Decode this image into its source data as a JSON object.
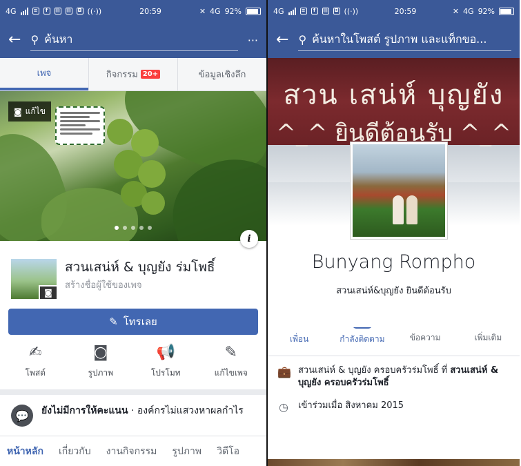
{
  "left": {
    "status": {
      "network": "4G",
      "time": "20:59",
      "battery": "92%",
      "net2": "4G"
    },
    "search": {
      "placeholder": "ค้นหา",
      "more": "···"
    },
    "tabs": [
      {
        "label": "เพจ",
        "active": true
      },
      {
        "label": "กิจกรรม",
        "badge": "20+"
      },
      {
        "label": "ข้อมูลเชิงลึก"
      }
    ],
    "cover": {
      "edit_label": "แก้ไข"
    },
    "page": {
      "name": "สวนเสน่ห์ & บุญยัง ร่มโพธิ์",
      "username_prompt": "สร้างชื่อผู้ใช้ของเพจ"
    },
    "call_label": "โทรเลย",
    "actions": [
      {
        "label": "โพสต์",
        "icon": "edit-square-icon"
      },
      {
        "label": "รูปภาพ",
        "icon": "camera-icon"
      },
      {
        "label": "โปรโมท",
        "icon": "megaphone-icon"
      },
      {
        "label": "แก้ไขเพจ",
        "icon": "pencil-icon"
      }
    ],
    "rating": {
      "bold": "ยังไม่มีการให้คะแนน",
      "rest": " · องค์กรไม่แสวงหาผลกำไร"
    },
    "nav": [
      "หน้าหลัก",
      "เกี่ยวกับ",
      "งานกิจกรรม",
      "รูปภาพ",
      "วิดีโอ"
    ]
  },
  "right": {
    "status": {
      "network": "4G",
      "time": "20:59",
      "battery": "92%",
      "net2": "4G"
    },
    "search": {
      "placeholder": "ค้นหาในโพสต์ รูปภาพ และแท็กขอ..."
    },
    "banner": {
      "line1": "สวน เสน่ห์ บุญยัง",
      "line2": "^_^ ยินดีต้อนรับ ^_^"
    },
    "profile": {
      "name": "Bunyang Rompho",
      "bio": "สวนเสน่ห์&บุญยัง ยินดีต้อนรับ"
    },
    "actions": [
      {
        "label": "เพื่อน",
        "icon": "friend-check-icon",
        "active": true
      },
      {
        "label": "กำลังติดตาม",
        "icon": "following-check-icon",
        "active": true
      },
      {
        "label": "ข้อความ",
        "icon": "messenger-icon"
      },
      {
        "label": "เพิ่มเติม",
        "icon": "more-icon"
      }
    ],
    "work": {
      "prefix": "สวนเสน่ห์ & บุญยัง ครอบครัวร่มโพธิ์ ที่ ",
      "bold": "สวนเสน่ห์ & บุญยัง ครอบครัวร่มโพธิ์"
    },
    "joined": "เข้าร่วมเมื่อ สิงหาคม 2015"
  },
  "colors": {
    "facebook_blue": "#3b5998",
    "button_blue": "#4267b2",
    "badge_red": "#fa3e3e"
  }
}
